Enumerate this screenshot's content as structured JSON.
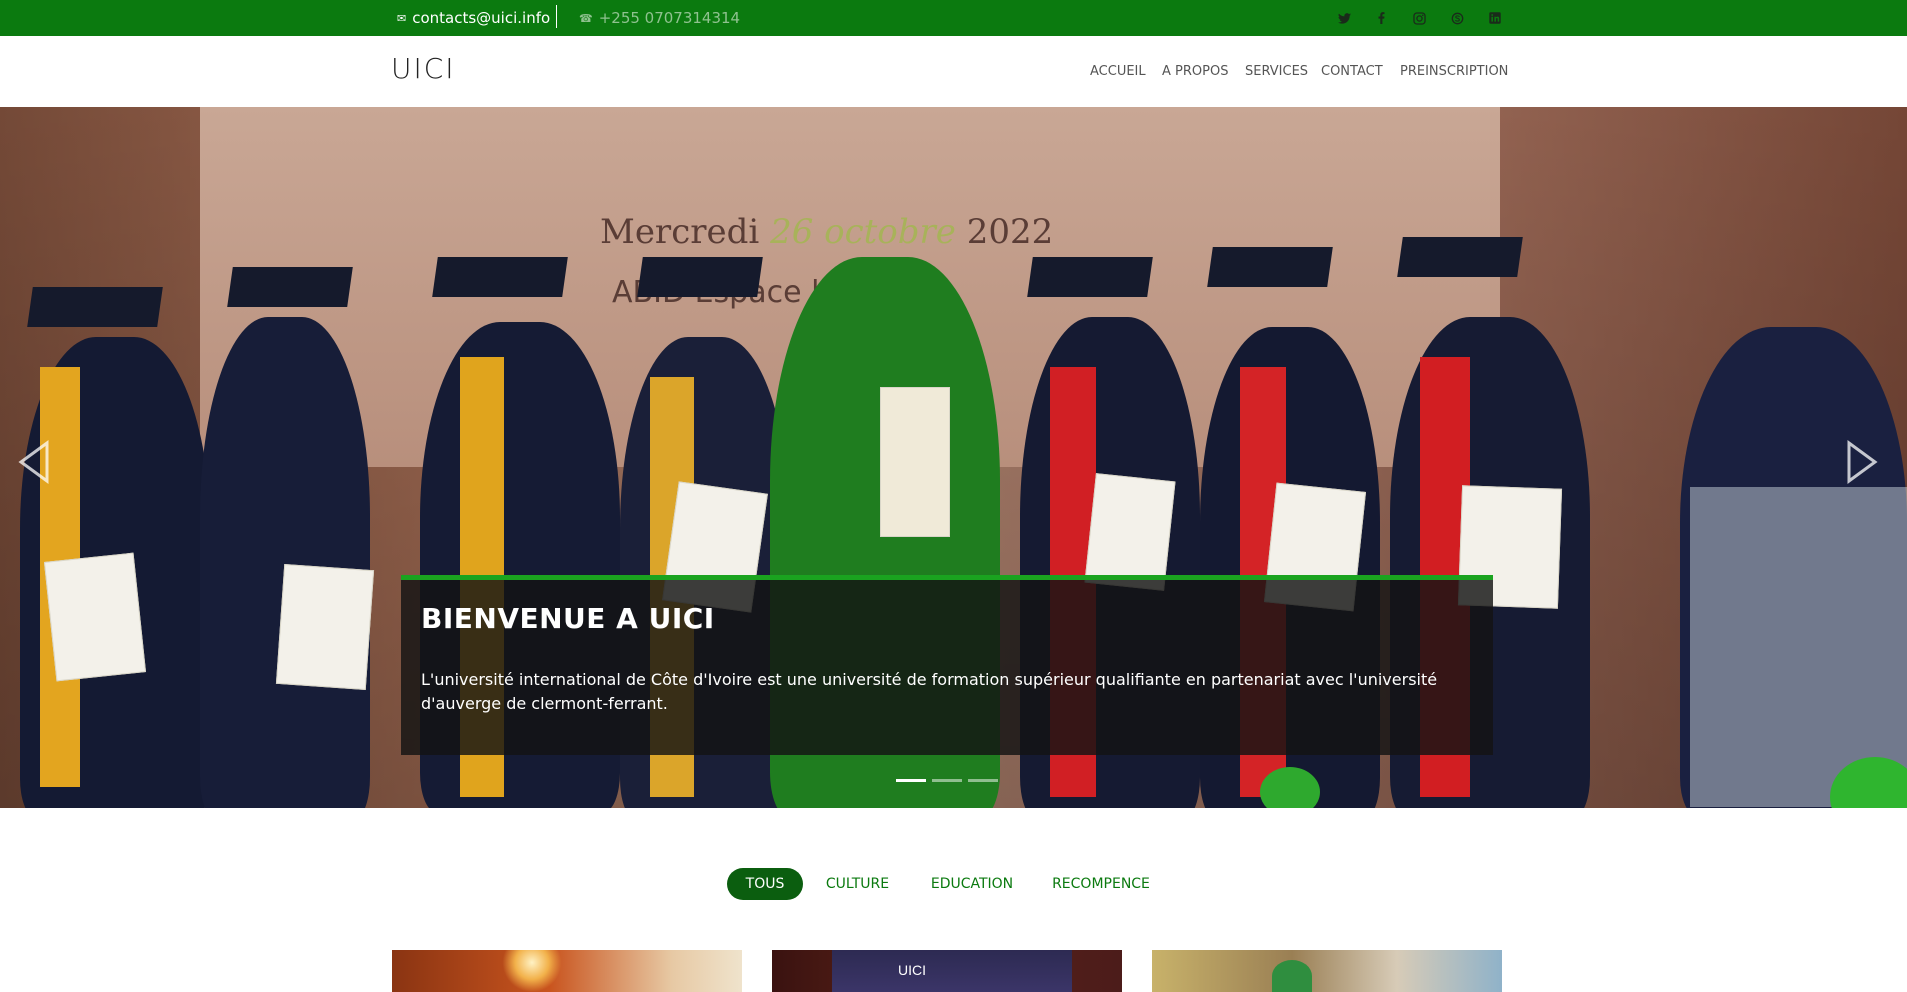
{
  "topbar": {
    "email": "contacts@uici.info",
    "phone": "+255 0707314314",
    "social": [
      "twitter-icon",
      "facebook-icon",
      "instagram-icon",
      "skype-icon",
      "linkedin-icon"
    ],
    "bg_color": "#0b7a0f"
  },
  "header": {
    "logo": "UICI",
    "nav": [
      "ACCUEIL",
      "A PROPOS",
      "SERVICES",
      "CONTACT",
      "PREINSCRIPTION"
    ]
  },
  "hero": {
    "banner_date_prefix": "Mercredi",
    "banner_date_cursive": "26 octobre",
    "banner_year": "2022",
    "banner_sub": "ABID     Espace     lle Event",
    "title": "BIENVENUE A UICI",
    "text": "L'université international de Côte d'Ivoire est une université de formation supérieur qualifiante en partenariat avec l'université d'auverge de clermont-ferrant.",
    "slide_count": 3,
    "active_slide": 1,
    "accent_color": "#1aa31f"
  },
  "filters": {
    "items": [
      "TOUS",
      "CULTURE",
      "EDUCATION",
      "RECOMPENCE"
    ],
    "active": "TOUS"
  },
  "gallery": {
    "thumb2_caption": "UICI"
  }
}
